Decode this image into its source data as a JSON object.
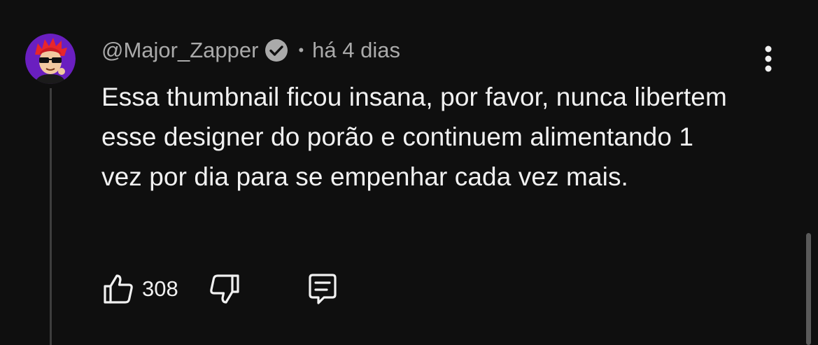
{
  "comment": {
    "author": "@Major_Zapper",
    "separator": "•",
    "timestamp": "há 4 dias",
    "text": "Essa thumbnail ficou insana, por favor, nunca libertem esse designer do porão e continuem alimentando 1 vez por dia para se empenhar cada vez mais.",
    "like_count": "308"
  },
  "icons": {
    "avatar": "avatar-red-hair-sunglasses",
    "verified": "verified-check-icon",
    "more": "more-vertical-icon",
    "like": "thumbs-up-icon",
    "dislike": "thumbs-down-icon",
    "reply": "reply-comment-icon"
  },
  "colors": {
    "background": "#0f0f0f",
    "text_primary": "#f1f1f1",
    "text_secondary": "#aaaaaa",
    "avatar_bg": "#6a1fc0"
  }
}
